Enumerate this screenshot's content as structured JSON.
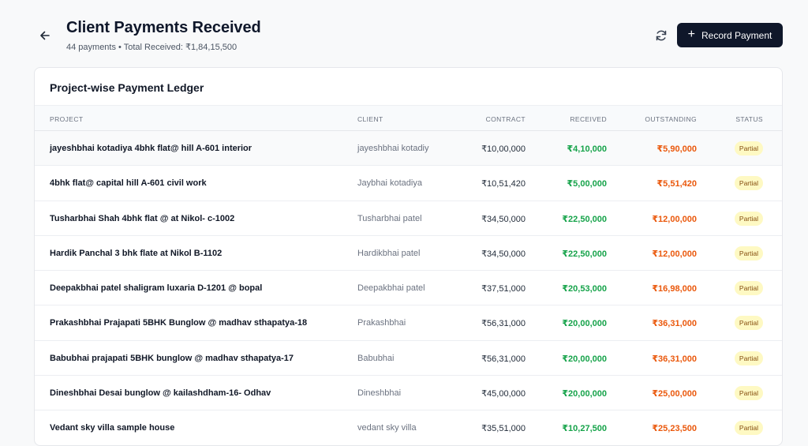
{
  "header": {
    "title": "Client Payments Received",
    "subtitle": "44 payments • Total Received: ₹1,84,15,500",
    "record_button_label": "Record Payment",
    "icons": {
      "back": "arrow-left-icon",
      "refresh": "refresh-icon",
      "add": "plus-icon"
    }
  },
  "ledger": {
    "title": "Project-wise Payment Ledger",
    "columns": {
      "project": "PROJECT",
      "client": "CLIENT",
      "contract": "CONTRACT",
      "received": "RECEIVED",
      "outstanding": "OUTSTANDING",
      "status": "STATUS"
    },
    "rows": [
      {
        "project": "jayeshbhai kotadiya 4bhk flat@ hill A-601 interior",
        "client": "jayeshbhai kotadiy",
        "contract": "₹10,00,000",
        "received": "₹4,10,000",
        "outstanding": "₹5,90,000",
        "status": "Partial"
      },
      {
        "project": "4bhk flat@ capital hill A-601 civil work",
        "client": "Jaybhai kotadiya",
        "contract": "₹10,51,420",
        "received": "₹5,00,000",
        "outstanding": "₹5,51,420",
        "status": "Partial"
      },
      {
        "project": "Tusharbhai Shah 4bhk flat @ at Nikol- c-1002",
        "client": "Tusharbhai patel",
        "contract": "₹34,50,000",
        "received": "₹22,50,000",
        "outstanding": "₹12,00,000",
        "status": "Partial"
      },
      {
        "project": "Hardik Panchal 3 bhk flate at Nikol B-1102",
        "client": "Hardikbhai patel",
        "contract": "₹34,50,000",
        "received": "₹22,50,000",
        "outstanding": "₹12,00,000",
        "status": "Partial"
      },
      {
        "project": "Deepakbhai patel shaligram luxaria D-1201 @ bopal",
        "client": "Deepakbhai patel",
        "contract": "₹37,51,000",
        "received": "₹20,53,000",
        "outstanding": "₹16,98,000",
        "status": "Partial"
      },
      {
        "project": "Prakashbhai Prajapati 5BHK Bunglow @ madhav sthapatya-18",
        "client": "Prakashbhai",
        "contract": "₹56,31,000",
        "received": "₹20,00,000",
        "outstanding": "₹36,31,000",
        "status": "Partial"
      },
      {
        "project": "Babubhai prajapati 5BHK bunglow @ madhav sthapatya-17",
        "client": "Babubhai",
        "contract": "₹56,31,000",
        "received": "₹20,00,000",
        "outstanding": "₹36,31,000",
        "status": "Partial"
      },
      {
        "project": "Dineshbhai Desai bunglow @ kailashdham-16- Odhav",
        "client": "Dineshbhai",
        "contract": "₹45,00,000",
        "received": "₹20,00,000",
        "outstanding": "₹25,00,000",
        "status": "Partial"
      },
      {
        "project": "Vedant sky villa sample house",
        "client": "vedant sky villa",
        "contract": "₹35,51,000",
        "received": "₹10,27,500",
        "outstanding": "₹25,23,500",
        "status": "Partial"
      }
    ]
  },
  "colors": {
    "primary_button": "#0f172a",
    "received": "#16a34a",
    "outstanding": "#ea580c",
    "badge_bg": "#fef9c3",
    "badge_text": "#854d0e"
  }
}
